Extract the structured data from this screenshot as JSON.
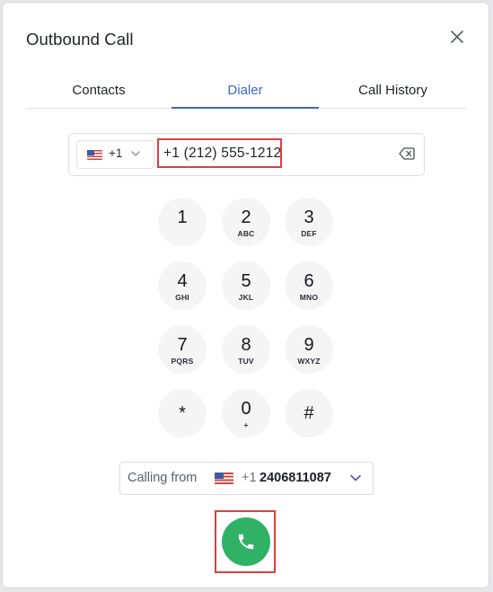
{
  "dialog": {
    "title": "Outbound Call",
    "close_icon": "close-icon"
  },
  "tabs": [
    {
      "label": "Contacts",
      "active": false
    },
    {
      "label": "Dialer",
      "active": true
    },
    {
      "label": "Call History",
      "active": false
    }
  ],
  "dialer": {
    "country_code": "+1",
    "country_flag": "us-flag-icon",
    "number_value": "+1 (212) 555-1212",
    "backspace_icon": "backspace-icon"
  },
  "keypad": [
    {
      "digit": "1",
      "letters": ""
    },
    {
      "digit": "2",
      "letters": "ABC"
    },
    {
      "digit": "3",
      "letters": "DEF"
    },
    {
      "digit": "4",
      "letters": "GHI"
    },
    {
      "digit": "5",
      "letters": "JKL"
    },
    {
      "digit": "6",
      "letters": "MNO"
    },
    {
      "digit": "7",
      "letters": "PQRS"
    },
    {
      "digit": "8",
      "letters": "TUV"
    },
    {
      "digit": "9",
      "letters": "WXYZ"
    },
    {
      "digit": "*",
      "letters": ""
    },
    {
      "digit": "0",
      "letters": "+"
    },
    {
      "digit": "#",
      "letters": ""
    }
  ],
  "calling_from": {
    "label": "Calling from",
    "prefix": "+1",
    "number": "2406811087",
    "flag": "us-flag-icon"
  },
  "call_button": {
    "icon": "phone-icon"
  },
  "colors": {
    "accent": "#3f66c8",
    "call_green": "#2fb265",
    "highlight_red": "#d9413f"
  }
}
